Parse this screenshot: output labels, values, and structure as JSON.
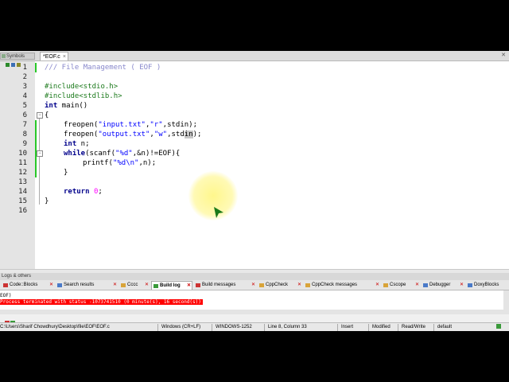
{
  "editor": {
    "tab_label": "*EOF.c",
    "tab_close": "×",
    "mgmt_stub": "Symbols",
    "line_numbers": [
      "1",
      "2",
      "3",
      "4",
      "5",
      "6",
      "7",
      "8",
      "9",
      "10",
      "11",
      "12",
      "13",
      "14",
      "15",
      "16"
    ]
  },
  "code": {
    "l1": "/// File Management ( EOF )",
    "l3": "#include<stdio.h>",
    "l4": "#include<stdlib.h>",
    "l5_kw": "int",
    "l5_rest": " main()",
    "l6": "{",
    "l7_a": "freopen(",
    "l7_s1": "\"input.txt\"",
    "l7_b": ",",
    "l7_s2": "\"r\"",
    "l7_c": ",stdin);",
    "l8_a": "freopen(",
    "l8_s1": "\"output.txt\"",
    "l8_b": ",",
    "l8_s2": "\"w\"",
    "l8_c": ",std",
    "l8_hl": "in",
    "l8_d": ");",
    "l9_kw": "int",
    "l9_rest": " n;",
    "l10_kw": "while",
    "l10_a": "(scanf(",
    "l10_s": "\"%d\"",
    "l10_b": ",&n)!=EOF)",
    "l10_c": "{",
    "l11_a": "printf(",
    "l11_s": "\"%d\\n\"",
    "l11_b": ",n);",
    "l12": "}",
    "l14_kw": "return",
    "l14_num": "0",
    "l14_rest": ";",
    "l15": "}"
  },
  "panel": {
    "title": "Logs & others",
    "tabs": [
      "Code::Blocks",
      "Search results",
      "Cccc",
      "Build log",
      "Build messages",
      "CppCheck",
      "CppCheck messages",
      "Cscope",
      "Debugger",
      "DoxyBlocks"
    ],
    "active_tab": "Build log",
    "log_line1": "EOF)",
    "log_line2": "Process terminated with status -1073741510 (0 minute(s), 16 second(s))"
  },
  "status": {
    "path": "C:\\Users\\Sharif Chowdhury\\Desktop\\file\\EOF\\EOF.c",
    "eol": "Windows (CR+LF)",
    "encoding": "WINDOWS-1252",
    "position": "Line 8, Column 33",
    "mode": "Insert",
    "modified": "Modified",
    "access": "Read/Write",
    "profile": "default"
  },
  "colors": {
    "change_bar": "#28c828",
    "error_line": "#ff0000",
    "cursor_halo": "#fff578"
  }
}
